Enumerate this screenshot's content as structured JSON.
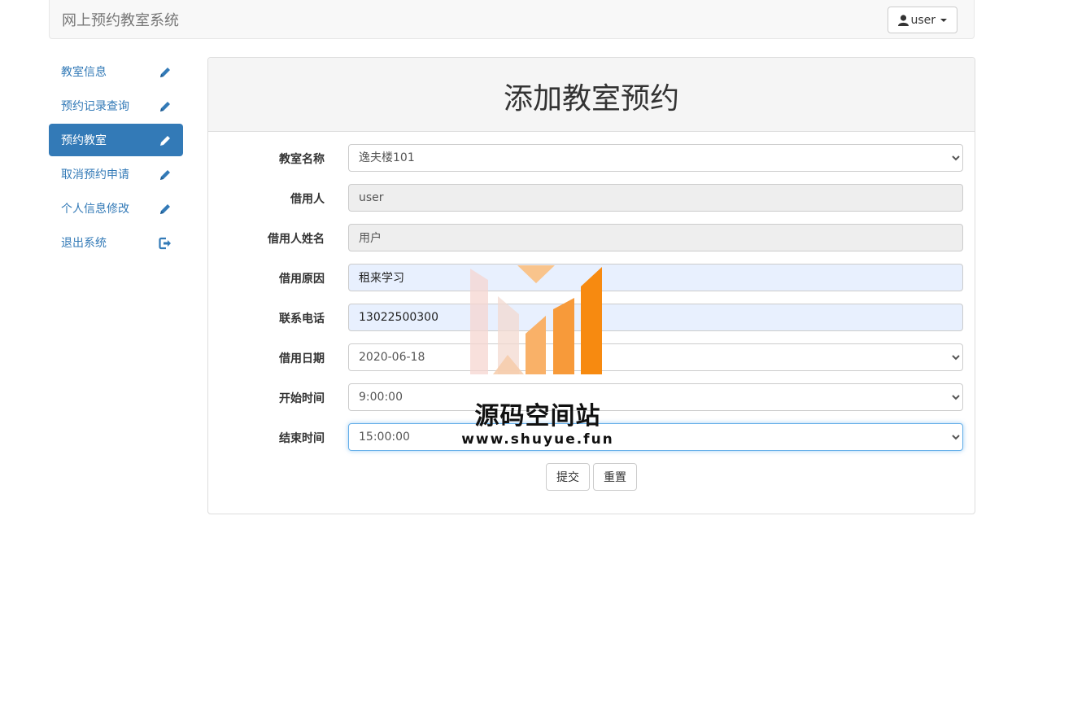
{
  "navbar": {
    "brand": "网上预约教室系统",
    "user_menu_label": "user"
  },
  "sidebar": {
    "items": [
      {
        "label": "教室信息",
        "icon": "pencil-icon"
      },
      {
        "label": "预约记录查询",
        "icon": "pencil-icon"
      },
      {
        "label": "预约教室",
        "icon": "pencil-icon",
        "active": true
      },
      {
        "label": "取消预约申请",
        "icon": "pencil-icon"
      },
      {
        "label": "个人信息修改",
        "icon": "pencil-icon"
      },
      {
        "label": "退出系统",
        "icon": "log-out-icon"
      }
    ]
  },
  "form": {
    "title": "添加教室预约",
    "fields": {
      "classroom": {
        "label": "教室名称",
        "value": "逸夫楼101"
      },
      "borrower": {
        "label": "借用人",
        "value": "user"
      },
      "borrower_name": {
        "label": "借用人姓名",
        "value": "用户"
      },
      "reason": {
        "label": "借用原因",
        "value": "租来学习"
      },
      "phone": {
        "label": "联系电话",
        "value": "13022500300"
      },
      "date": {
        "label": "借用日期",
        "value": "2020-06-18"
      },
      "start_time": {
        "label": "开始时间",
        "value": "9:00:00"
      },
      "end_time": {
        "label": "结束时间",
        "value": "15:00:00"
      }
    },
    "submit_label": "提交",
    "reset_label": "重置"
  },
  "watermark": {
    "text": "源码空间站",
    "url": "www.shuyue.fun"
  },
  "colors": {
    "primary": "#337ab7",
    "watermark_orange": "#f7931e"
  }
}
